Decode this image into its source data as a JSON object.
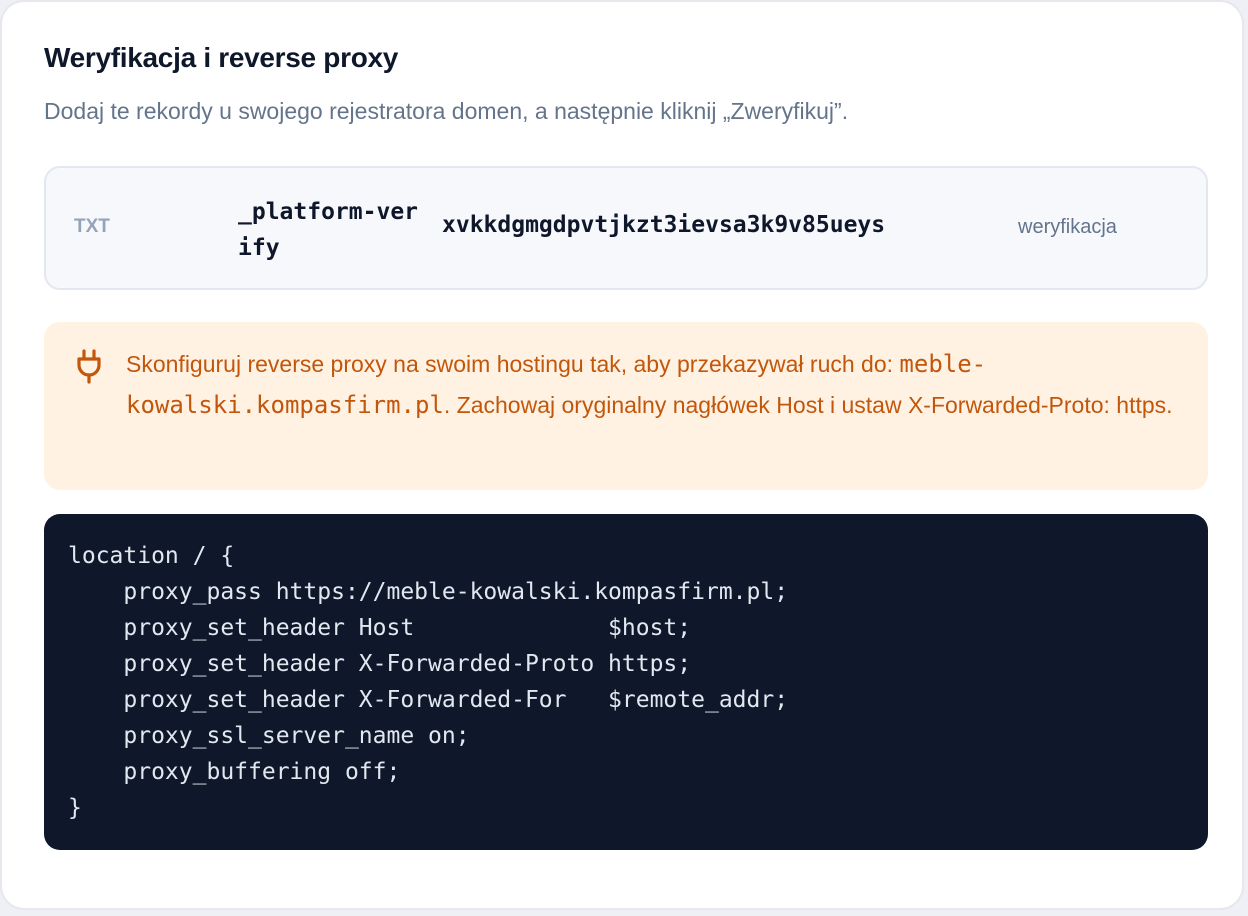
{
  "section": {
    "title": "Weryfikacja i reverse proxy",
    "subtitle": "Dodaj te rekordy u swojego rejestratora domen, a następnie kliknij „Zweryfikuj”."
  },
  "record": {
    "type": "TXT",
    "name": "_platform-verify",
    "value": "xvkkdgmgdpvtjkzt3ievsa3k9v85ueys",
    "purpose": "weryfikacja"
  },
  "notice": {
    "icon": "plug-icon",
    "color": "#c2570c",
    "text_before": "Skonfiguruj reverse proxy na swoim hostingu tak, aby przekazywał ruch do: ",
    "target": "meble-kowalski.kompasfirm.pl",
    "text_after": ". Zachowaj oryginalny nagłówek Host i ustaw X-Forwarded-Proto: https."
  },
  "code": {
    "content": "location / {\n    proxy_pass https://meble-kowalski.kompasfirm.pl;\n    proxy_set_header Host              $host;\n    proxy_set_header X-Forwarded-Proto https;\n    proxy_set_header X-Forwarded-For   $remote_addr;\n    proxy_ssl_server_name on;\n    proxy_buffering off;\n}"
  }
}
